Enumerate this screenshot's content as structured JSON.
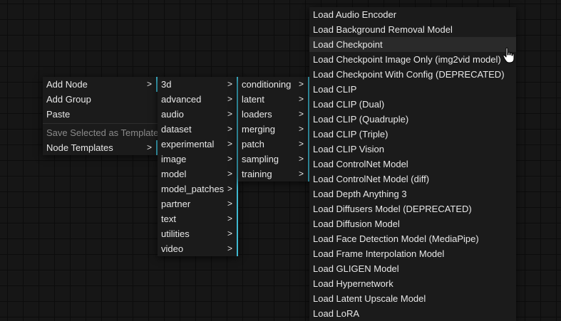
{
  "root_menu": {
    "add_node": "Add Node",
    "add_group": "Add Group",
    "paste": "Paste",
    "save_template": "Save Selected as Template",
    "node_templates": "Node Templates"
  },
  "submenu_arrow": ">",
  "category_menu": [
    "3d",
    "advanced",
    "audio",
    "dataset",
    "experimental",
    "image",
    "model",
    "model_patches",
    "partner",
    "text",
    "utilities",
    "video"
  ],
  "loaders_menu": [
    "conditioning",
    "latent",
    "loaders",
    "merging",
    "patch",
    "sampling",
    "training"
  ],
  "node_list": [
    "Load Audio Encoder",
    "Load Background Removal Model",
    "Load Checkpoint",
    "Load Checkpoint Image Only (img2vid model)",
    "Load Checkpoint With Config (DEPRECATED)",
    "Load CLIP",
    "Load CLIP (Dual)",
    "Load CLIP (Quadruple)",
    "Load CLIP (Triple)",
    "Load CLIP Vision",
    "Load ControlNet Model",
    "Load ControlNet Model (diff)",
    "Load Depth Anything 3",
    "Load Diffusers Model (DEPRECATED)",
    "Load Diffusion Model",
    "Load Face Detection Model (MediaPipe)",
    "Load Frame Interpolation Model",
    "Load GLIGEN Model",
    "Load Hypernetwork",
    "Load Latent Upscale Model",
    "Load LoRA"
  ],
  "hovered_node": "Load Checkpoint",
  "accent_color": "#3fb8d0",
  "cursor_icon": "hand-pointer-icon"
}
